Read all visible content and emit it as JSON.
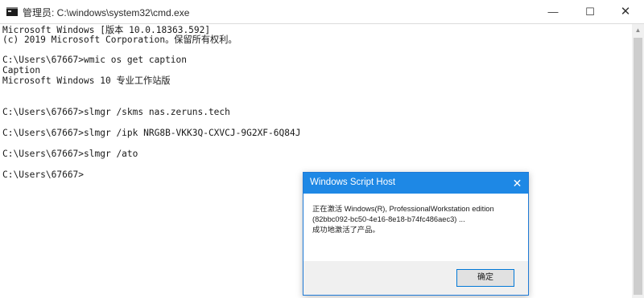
{
  "window": {
    "title": "管理员: C:\\windows\\system32\\cmd.exe",
    "icon": "cmd-icon",
    "controls": {
      "minimize": "—",
      "maximize": "☐",
      "close": "✕"
    }
  },
  "console": {
    "lines": [
      "Microsoft Windows [版本 10.0.18363.592]",
      "(c) 2019 Microsoft Corporation。保留所有权利。",
      "C:\\Users\\67667>wmic os get caption",
      "Caption",
      "Microsoft Windows 10 专业工作站版",
      "C:\\Users\\67667>slmgr /skms nas.zeruns.tech",
      "C:\\Users\\67667>slmgr /ipk NRG8B-VKK3Q-CXVCJ-9G2XF-6Q84J",
      "C:\\Users\\67667>slmgr /ato",
      "C:\\Users\\67667>"
    ]
  },
  "scrollbar": {
    "up_arrow": "▲"
  },
  "dialog": {
    "title": "Windows Script Host",
    "close": "✕",
    "message": [
      "正在激活 Windows(R), ProfessionalWorkstation edition",
      "(82bbc092-bc50-4e16-8e18-b74fc486aec3) ...",
      "成功地激活了产品。"
    ],
    "ok_label": "确定"
  }
}
